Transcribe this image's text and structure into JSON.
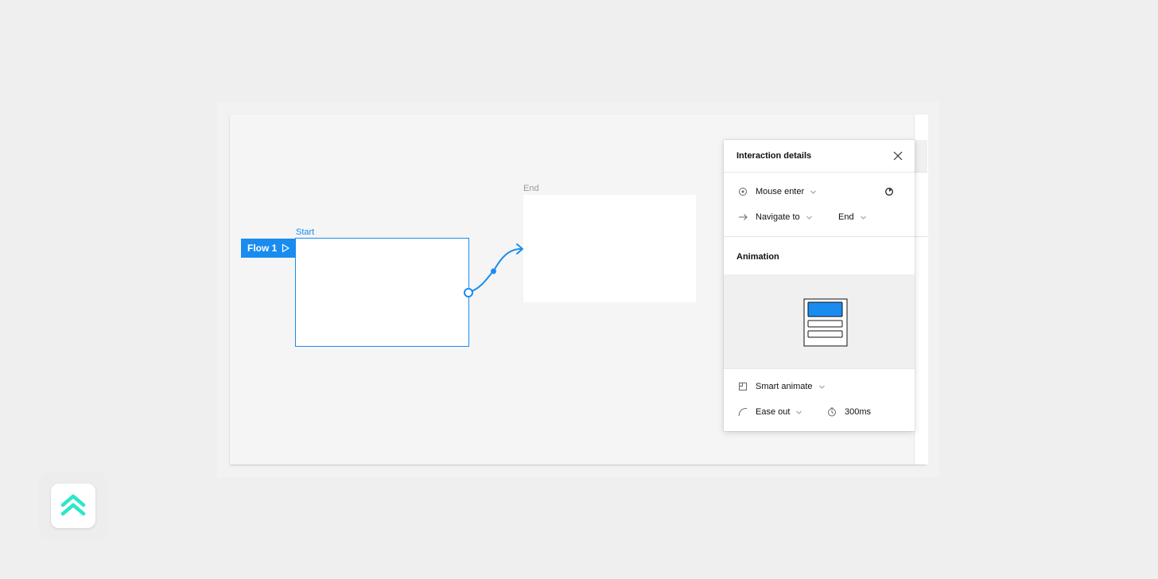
{
  "canvas": {
    "frames": {
      "start_label": "Start",
      "end_label": "End"
    },
    "flow_badge": {
      "label": "Flow 1",
      "play_icon": "play-icon"
    },
    "accent_color": "#1a8cf0"
  },
  "interaction_panel": {
    "title": "Interaction details",
    "close_icon": "close-icon",
    "trigger": {
      "icon": "trigger-icon",
      "label": "Mouse enter",
      "delay_icon": "delay-timer-icon"
    },
    "action": {
      "icon": "arrow-right-icon",
      "label": "Navigate to",
      "destination": "End"
    },
    "animation": {
      "section_title": "Animation",
      "type_icon": "smart-animate-icon",
      "type_label": "Smart animate",
      "easing_icon": "easing-curve-icon",
      "easing_label": "Ease out",
      "duration_icon": "clock-icon",
      "duration": "300ms"
    }
  },
  "app_logo": {
    "icon": "double-chevron-up-logo",
    "color": "#2ee6c8"
  }
}
